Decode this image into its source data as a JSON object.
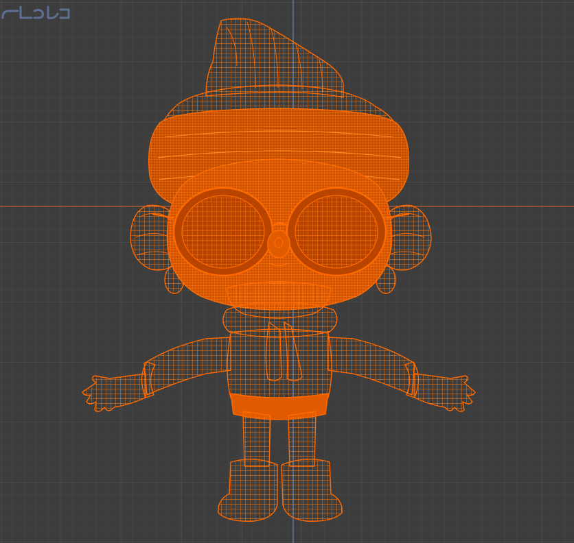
{
  "viewport": {
    "colors": {
      "background": "#3d3d3d",
      "grid_minor": "#474747",
      "grid_major": "#555555",
      "axis_x": "#c4563a",
      "axis_y": "#6f86b6",
      "wire": "#ff6a00",
      "fill_deep": "#b84400",
      "fill_mid": "#e05a00",
      "fill_light": "#ff7a10",
      "watermark": "#5e6f94"
    },
    "icons": {
      "watermark": "watermark-logo-icon"
    }
  }
}
